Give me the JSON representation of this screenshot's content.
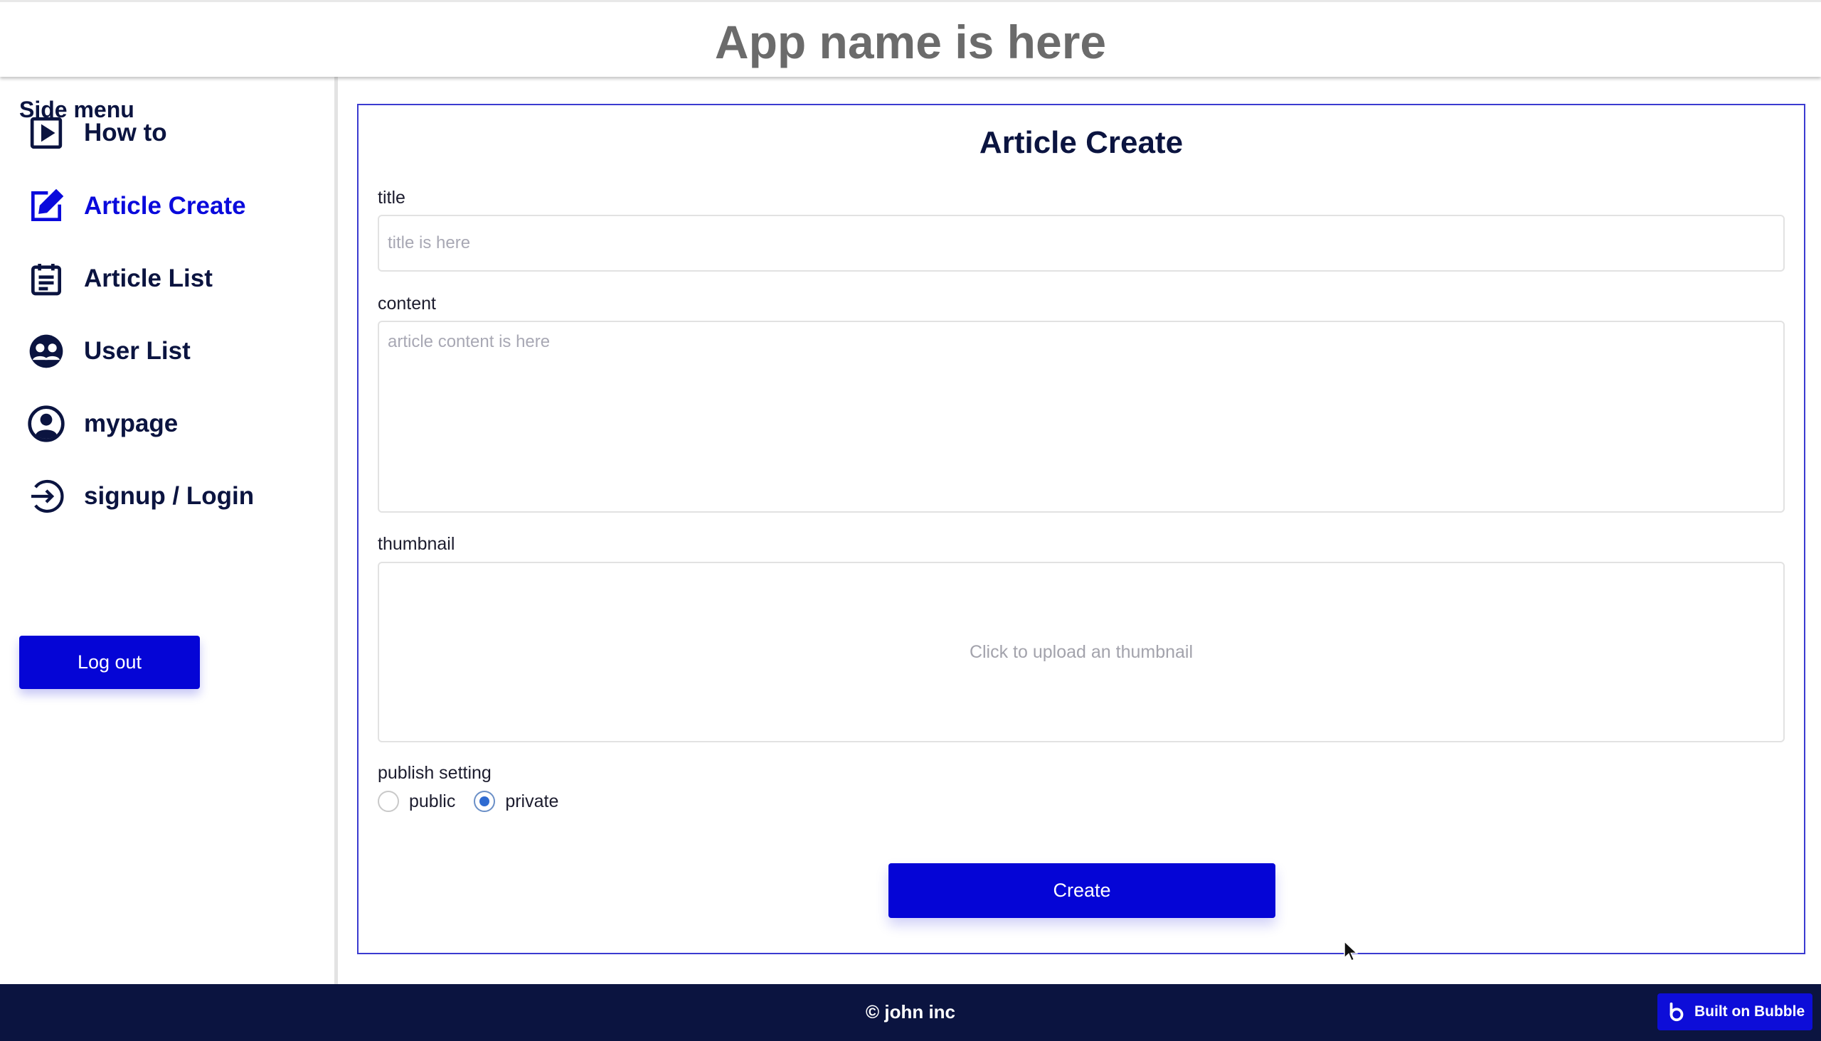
{
  "header": {
    "app_title": "App name is here"
  },
  "sidebar": {
    "heading": "Side menu",
    "items": [
      {
        "label": "How to",
        "icon": "play-icon",
        "active": false
      },
      {
        "label": "Article Create",
        "icon": "edit-icon",
        "active": true
      },
      {
        "label": "Article List",
        "icon": "list-icon",
        "active": false
      },
      {
        "label": "User List",
        "icon": "users-icon",
        "active": false
      },
      {
        "label": "mypage",
        "icon": "user-circle-icon",
        "active": false
      },
      {
        "label": "signup / Login",
        "icon": "login-icon",
        "active": false
      }
    ],
    "logout_label": "Log out"
  },
  "main": {
    "title": "Article Create",
    "title_field": {
      "label": "title",
      "placeholder": "title is here",
      "value": ""
    },
    "content_field": {
      "label": "content",
      "placeholder": "article content is here",
      "value": ""
    },
    "thumbnail_field": {
      "label": "thumbnail",
      "upload_text": "Click to upload an thumbnail"
    },
    "publish_setting": {
      "label": "publish setting",
      "options": [
        {
          "label": "public",
          "checked": false
        },
        {
          "label": "private",
          "checked": true
        }
      ]
    },
    "create_label": "Create"
  },
  "footer": {
    "copyright": "© john inc",
    "badge_label": "Built on Bubble"
  },
  "colors": {
    "brand_blue": "#0505d6",
    "active_nav": "#0a0adc",
    "navy": "#0b1440",
    "panel_border": "#3b3bd0"
  }
}
